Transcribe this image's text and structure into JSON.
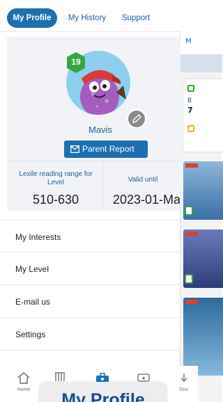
{
  "tabs": [
    {
      "label": "My Profile",
      "active": true
    },
    {
      "label": "My History",
      "active": false
    },
    {
      "label": "Support",
      "active": false
    }
  ],
  "profile": {
    "level_badge": "19",
    "username": "Mavis",
    "parent_report_label": "Parent Report",
    "avatar_icon": "monster-avatar-icon"
  },
  "stats": {
    "lexile_label": "Lexile reading range for Level",
    "lexile_value": "510-630",
    "valid_label": "Valid until",
    "valid_value": "2023-01-Ma"
  },
  "menu": [
    {
      "label": "My Interests"
    },
    {
      "label": "My Level"
    },
    {
      "label": "E-mail us"
    },
    {
      "label": "Settings"
    }
  ],
  "bottom_nav": [
    {
      "label": "Home",
      "icon": "home-icon"
    },
    {
      "label": "",
      "icon": "library-icon"
    },
    {
      "label": "",
      "icon": "briefcase-icon"
    },
    {
      "label": "",
      "icon": "favorite-ticket-icon"
    },
    {
      "label": "Dov",
      "icon": "download-icon"
    }
  ],
  "background_app": {
    "header_fragment": "M",
    "card_fragment_line1": "B",
    "card_fragment_line2": "7"
  },
  "tooltip": {
    "text": "My Profile"
  },
  "colors": {
    "primary": "#1d6fb0",
    "link": "#1f5e9a",
    "badge_green": "#37a642",
    "profile_bg": "#f1f3f6"
  }
}
